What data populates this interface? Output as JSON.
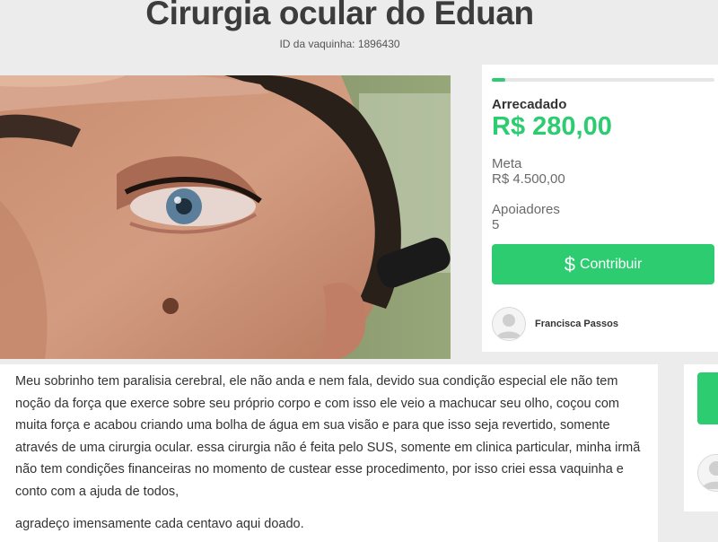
{
  "campaign": {
    "title": "Cirurgia ocular do Eduan",
    "id_text": "ID da vaquinha: 1896430"
  },
  "stats": {
    "raised_label": "Arrecadado",
    "raised_value": "R$ 280,00",
    "goal_label": "Meta",
    "goal_value": "R$ 4.500,00",
    "backers_label": "Apoiadores",
    "backers_value": "5",
    "progress_fraction": 0.062
  },
  "cta": {
    "icon": "dollar-sign-icon",
    "label": "Contribuir"
  },
  "organizer": {
    "name": "Francisca Passos",
    "avatar_icon": "user-avatar-icon"
  },
  "description": {
    "paragraph_1": "Meu sobrinho tem paralisia cerebral, ele não anda e nem fala, devido sua condição especial ele não tem noção da força que exerce sobre seu próprio corpo e com isso ele veio a machucar seu olho, coçou com muita força e acabou criando uma bolha de água em sua visão e para que isso seja revertido, somente através de uma cirurgia ocular. essa cirurgia não é feita pelo SUS, somente em clinica particular, minha irmã não tem condições financeiras no momento de custear esse procedimento, por isso criei essa vaquinha e conto com a ajuda de todos,",
    "paragraph_2": "agradeço imensamente cada centavo aqui doado."
  },
  "colors": {
    "accent": "#2ecc71",
    "background": "#ececec",
    "text": "#333333"
  }
}
